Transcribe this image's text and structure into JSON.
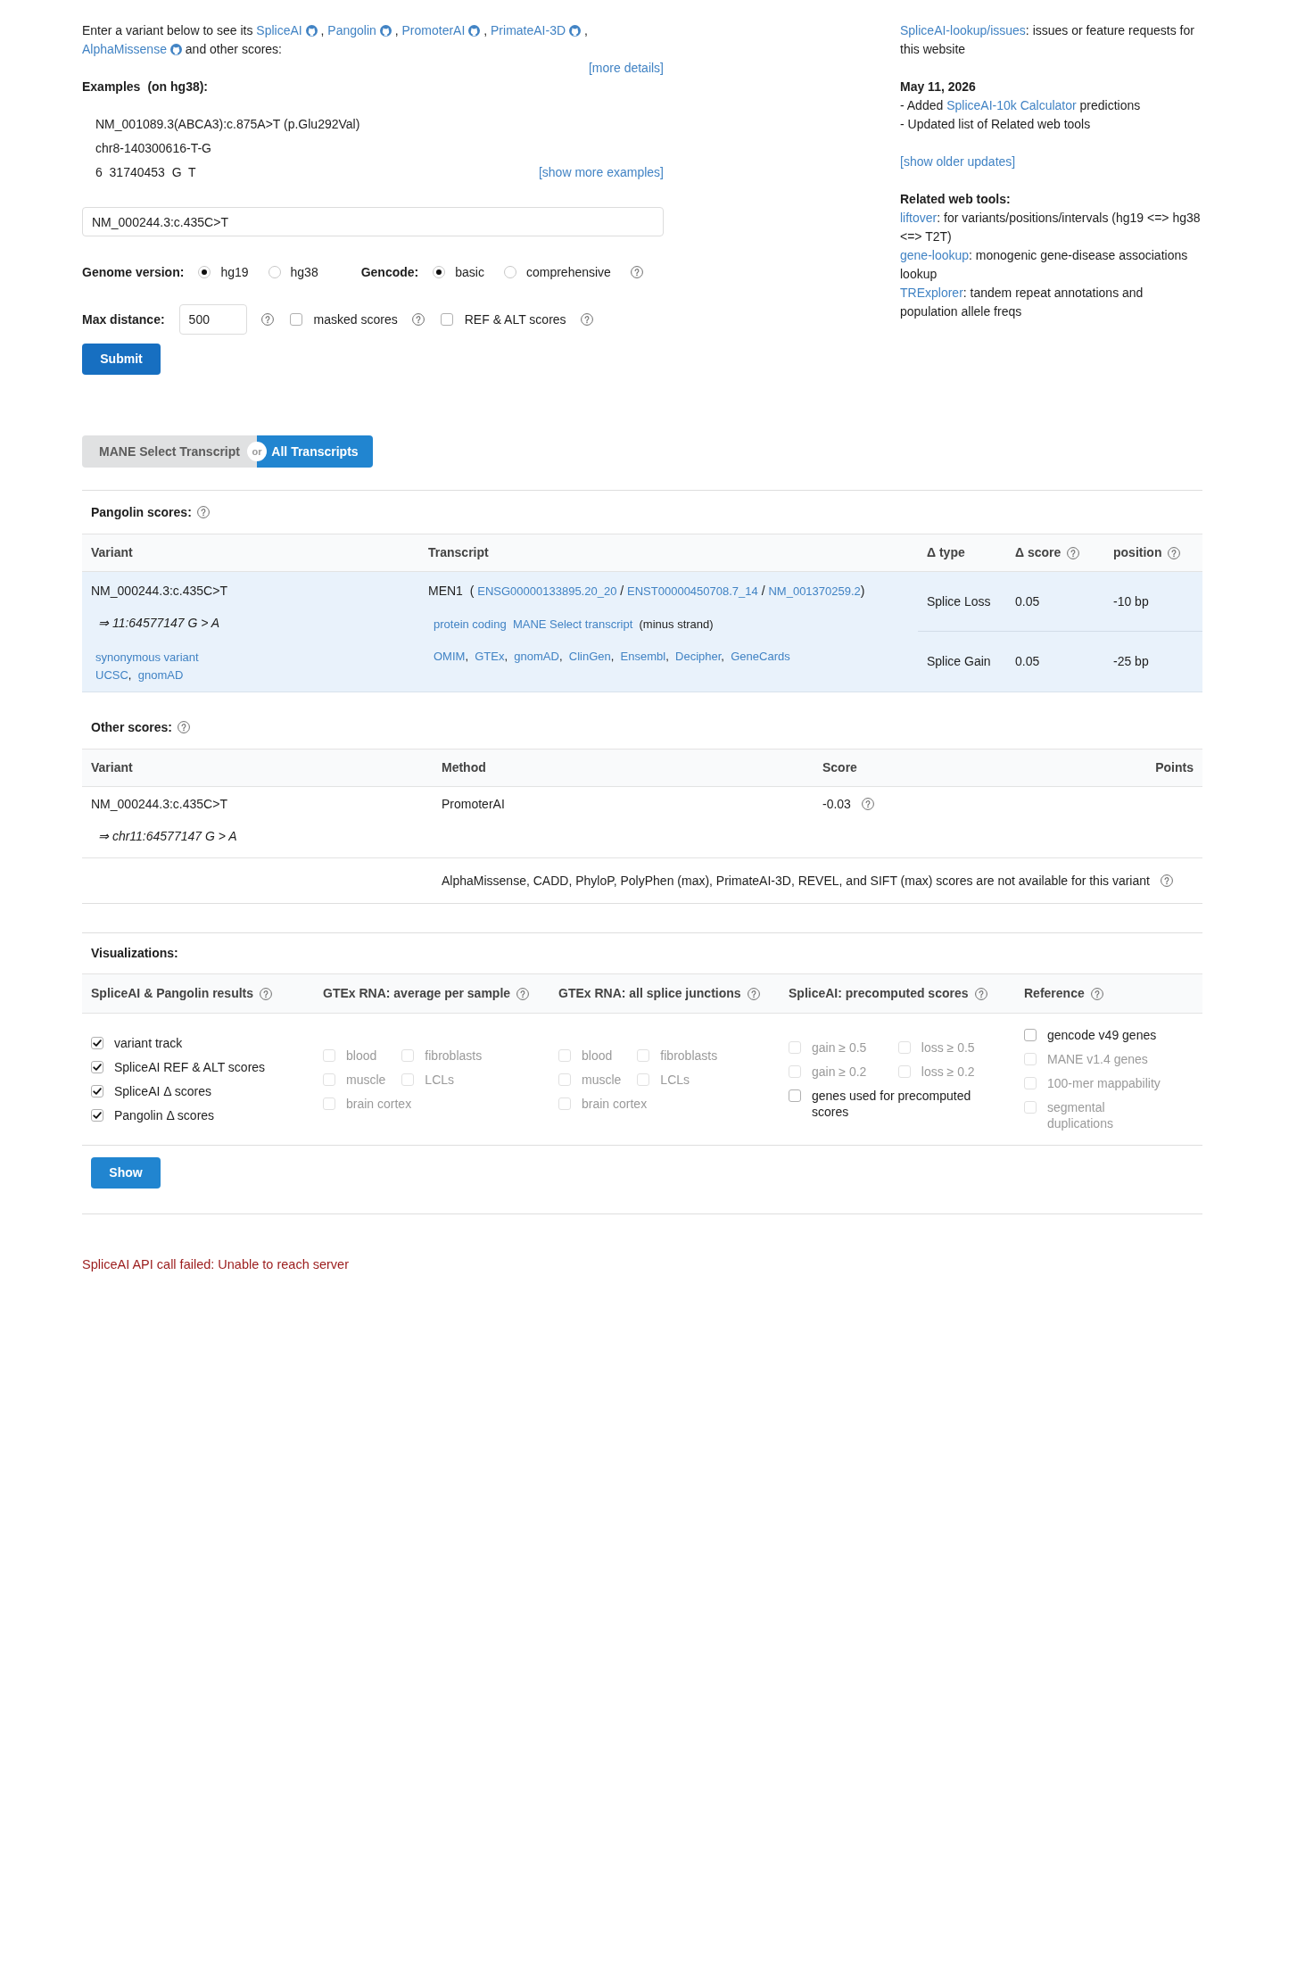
{
  "intro": {
    "lead": "Enter a variant below to see its",
    "tools": [
      {
        "label": "SpliceAI",
        "suffix": ","
      },
      {
        "label": "Pangolin",
        "suffix": ","
      },
      {
        "label": "PromoterAI",
        "suffix": ","
      },
      {
        "label": "PrimateAI-3D",
        "suffix": ","
      },
      {
        "label": "AlphaMissense"
      }
    ],
    "tail": "and other scores:"
  },
  "more_details": "[more details]",
  "examples": {
    "title": "Examples",
    "note": "(on hg38):",
    "items": [
      "NM_001089.3(ABCA3):c.875A>T (p.Glu292Val)",
      "chr8-140300616-T-G",
      "6  31740453  G  T"
    ],
    "more": "[show more examples]"
  },
  "variant_input": {
    "value": "NM_000244.3:c.435C>T"
  },
  "genome_version": {
    "label": "Genome version:",
    "options": [
      {
        "label": "hg19",
        "selected": true
      },
      {
        "label": "hg38",
        "selected": false
      }
    ]
  },
  "gencode": {
    "label": "Gencode:",
    "options": [
      {
        "label": "basic",
        "selected": true
      },
      {
        "label": "comprehensive",
        "selected": false
      }
    ],
    "help": true
  },
  "max_distance": {
    "label": "Max distance:",
    "value": "500",
    "help": true
  },
  "score_options": [
    {
      "label": "masked scores",
      "checked": false,
      "help": true
    },
    {
      "label": "REF & ALT scores",
      "checked": false,
      "help": true
    }
  ],
  "submit": "Submit",
  "sidebar": {
    "issues": {
      "link": "SpliceAI-lookup/issues",
      "text": ": issues or feature requests for this website"
    },
    "update": {
      "date": "May 11, 2026",
      "items": [
        {
          "before": "- Added ",
          "link": "SpliceAI-10k Calculator",
          "after": " predictions"
        },
        {
          "before": "- Updated list of Related web tools"
        }
      ]
    },
    "older": "[show older updates]",
    "related": {
      "title": "Related web tools:",
      "items": [
        {
          "link": "liftover",
          "text": ": for variants/positions/intervals (hg19 <=> hg38 <=> T2T)"
        },
        {
          "link": "gene-lookup",
          "text": ": monogenic gene-disease associations lookup"
        },
        {
          "link": "TRExplorer",
          "text": ": tandem repeat annotations and population allele freqs"
        }
      ]
    }
  },
  "transcript_toggle": {
    "options": [
      {
        "label": "MANE Select Transcript",
        "selected": false
      },
      {
        "label": "All Transcripts",
        "selected": true
      }
    ],
    "separator": "or"
  },
  "pangolin": {
    "title": "Pangolin scores:",
    "help": true,
    "columns": [
      {
        "label": "Variant",
        "help": false
      },
      {
        "label": "Transcript",
        "help": false
      },
      {
        "label": "Δ type",
        "help": false
      },
      {
        "label": "Δ score",
        "help": true
      },
      {
        "label": "position",
        "help": true
      }
    ],
    "variant": {
      "name": "NM_000244.3:c.435C>T",
      "position": "⇒ 11:64577147 G > A",
      "consequence": "synonymous variant",
      "links": [
        {
          "label": "UCSC",
          "suffix": ","
        },
        {
          "label": "gnomAD"
        }
      ]
    },
    "transcript": {
      "gene": "MEN1",
      "open": "(",
      "ids": [
        {
          "label": "ENSG00000133895.20_20",
          "suffix": "/"
        },
        {
          "label": "ENST00000450708.7_14",
          "suffix": "/"
        },
        {
          "label": "NM_001370259.2"
        }
      ],
      "close": ")",
      "tags": [
        {
          "label": "protein coding"
        },
        {
          "label": "MANE Select transcript"
        }
      ],
      "strand": "(minus strand)",
      "links": [
        {
          "label": "OMIM",
          "suffix": ","
        },
        {
          "label": "GTEx",
          "suffix": ","
        },
        {
          "label": "gnomAD",
          "suffix": ","
        },
        {
          "label": "ClinGen",
          "suffix": ","
        },
        {
          "label": "Ensembl",
          "suffix": ","
        },
        {
          "label": "Decipher",
          "suffix": ","
        },
        {
          "label": "GeneCards"
        }
      ]
    },
    "scores": [
      {
        "type": "Splice Loss",
        "score": "0.05",
        "position": "-10 bp"
      },
      {
        "type": "Splice Gain",
        "score": "0.05",
        "position": "-25 bp"
      }
    ]
  },
  "other_scores": {
    "title": "Other scores:",
    "help": true,
    "columns": [
      {
        "label": "Variant"
      },
      {
        "label": "Method"
      },
      {
        "label": "Score"
      },
      {
        "label": "Points"
      }
    ],
    "rows": [
      {
        "variant": "NM_000244.3:c.435C>T",
        "position": "⇒ chr11:64577147 G > A",
        "method": "PromoterAI",
        "score": "-0.03",
        "help": true
      }
    ],
    "note": {
      "text": "AlphaMissense, CADD, PhyloP, PolyPhen (max), PrimateAI-3D, REVEL, and SIFT (max) scores are not available for this variant",
      "help": true
    }
  },
  "visualizations": {
    "title": "Visualizations:",
    "groups": [
      {
        "title": "SpliceAI & Pangolin results",
        "help": true,
        "kind": "list",
        "items": [
          {
            "label": "variant track",
            "checked": true,
            "disabled": false
          },
          {
            "label": "SpliceAI REF & ALT scores",
            "checked": true,
            "disabled": false
          },
          {
            "label": "SpliceAI Δ scores",
            "checked": true,
            "disabled": false
          },
          {
            "label": "Pangolin Δ scores",
            "checked": true,
            "disabled": false
          }
        ]
      },
      {
        "title": "GTEx RNA: average per sample",
        "help": true,
        "kind": "grid",
        "items": [
          {
            "label": "blood",
            "checked": false,
            "disabled": true
          },
          {
            "label": "fibroblasts",
            "checked": false,
            "disabled": true
          },
          {
            "label": "muscle",
            "checked": false,
            "disabled": true
          },
          {
            "label": "LCLs",
            "checked": false,
            "disabled": true
          },
          {
            "label": "brain cortex",
            "checked": false,
            "disabled": true
          }
        ]
      },
      {
        "title": "GTEx RNA: all splice junctions",
        "help": true,
        "kind": "grid",
        "items": [
          {
            "label": "blood",
            "checked": false,
            "disabled": true
          },
          {
            "label": "fibroblasts",
            "checked": false,
            "disabled": true
          },
          {
            "label": "muscle",
            "checked": false,
            "disabled": true
          },
          {
            "label": "LCLs",
            "checked": false,
            "disabled": true
          },
          {
            "label": "brain cortex",
            "checked": false,
            "disabled": true
          }
        ]
      },
      {
        "title": "SpliceAI: precomputed scores",
        "help": true,
        "kind": "grid",
        "items": [
          {
            "label": "gain ≥ 0.5",
            "checked": false,
            "disabled": true
          },
          {
            "label": "loss ≥ 0.5",
            "checked": false,
            "disabled": true
          },
          {
            "label": "gain ≥ 0.2",
            "checked": false,
            "disabled": true
          },
          {
            "label": "loss ≥ 0.2",
            "checked": false,
            "disabled": true
          },
          {
            "label": "genes used for precomputed scores",
            "checked": false,
            "disabled": false
          }
        ]
      },
      {
        "title": "Reference",
        "help": true,
        "kind": "list",
        "items": [
          {
            "label": "gencode v49 genes",
            "checked": false,
            "disabled": false
          },
          {
            "label": "MANE v1.4 genes",
            "checked": false,
            "disabled": true
          },
          {
            "label": "100-mer mappability",
            "checked": false,
            "disabled": true
          },
          {
            "label": "segmental duplications",
            "checked": false,
            "disabled": true
          }
        ]
      }
    ]
  },
  "show_button": "Show",
  "error": "SpliceAI API call failed: Unable to reach server"
}
